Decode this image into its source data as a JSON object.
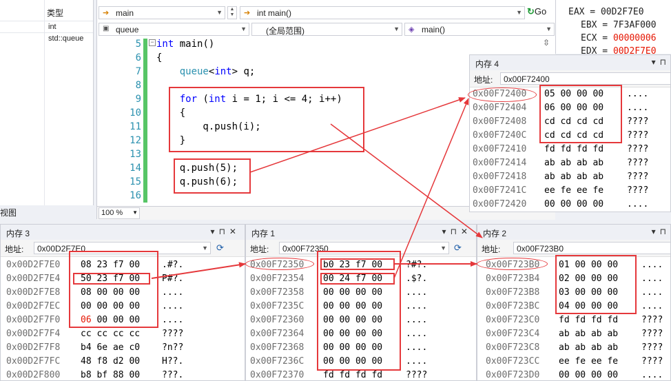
{
  "locals": {
    "header": "类型",
    "rows": [
      "int",
      "std::queue"
    ],
    "bottom_label": "视图"
  },
  "editor": {
    "nav_combo1": "main",
    "nav_combo2": "int main()",
    "go_label": "Go",
    "scope_combo1": "queue",
    "scope_combo2": "(全局范围)",
    "scope_combo3": "main()",
    "zoom": "100 %",
    "line_numbers": [
      "5",
      "6",
      "7",
      "8",
      "9",
      "10",
      "11",
      "12",
      "13",
      "14",
      "15",
      "16"
    ],
    "code_lines": [
      "int main()",
      "{",
      "    queue<int> q;",
      "",
      "    for (int i = 1; i <= 4; i++)",
      "    {",
      "        q.push(i);",
      "    }",
      "",
      "    q.push(5);",
      "    q.push(6);",
      ""
    ]
  },
  "registers": [
    {
      "name": "EAX",
      "value": "00D2F7E0",
      "changed": false
    },
    {
      "name": "EBX",
      "value": "7F3AF000",
      "changed": false
    },
    {
      "name": "ECX",
      "value": "00000006",
      "changed": true
    },
    {
      "name": "EDX",
      "value": "00D2F7E0",
      "changed": true
    }
  ],
  "mem4": {
    "title": "内存 4",
    "addr_label": "地址:",
    "address": "0x00F72400",
    "rows": [
      {
        "a": "0x00F72400",
        "h": "05 00 00 00",
        "c": "...."
      },
      {
        "a": "0x00F72404",
        "h": "06 00 00 00",
        "c": "...."
      },
      {
        "a": "0x00F72408",
        "h": "cd cd cd cd",
        "c": "????"
      },
      {
        "a": "0x00F7240C",
        "h": "cd cd cd cd",
        "c": "????"
      },
      {
        "a": "0x00F72410",
        "h": "fd fd fd fd",
        "c": "????"
      },
      {
        "a": "0x00F72414",
        "h": "ab ab ab ab",
        "c": "????"
      },
      {
        "a": "0x00F72418",
        "h": "ab ab ab ab",
        "c": "????"
      },
      {
        "a": "0x00F7241C",
        "h": "ee fe ee fe",
        "c": "????"
      },
      {
        "a": "0x00F72420",
        "h": "00 00 00 00",
        "c": "...."
      }
    ]
  },
  "mem3": {
    "title": "内存 3",
    "addr_label": "地址:",
    "address": "0x00D2F7E0",
    "rows": [
      {
        "a": "0x00D2F7E0",
        "h": "08 23 f7 00",
        "c": ".#?."
      },
      {
        "a": "0x00D2F7E4",
        "h": "50 23 f7 00",
        "c": "P#?."
      },
      {
        "a": "0x00D2F7E8",
        "h": "08 00 00 00",
        "c": "...."
      },
      {
        "a": "0x00D2F7EC",
        "h": "00 00 00 00",
        "c": "...."
      },
      {
        "a": "0x00D2F7F0",
        "h": "06 00 00 00",
        "c": "...."
      },
      {
        "a": "0x00D2F7F4",
        "h": "cc cc cc cc",
        "c": "????"
      },
      {
        "a": "0x00D2F7F8",
        "h": "b4 6e ae c0",
        "c": "?n??"
      },
      {
        "a": "0x00D2F7FC",
        "h": "48 f8 d2 00",
        "c": "H??."
      },
      {
        "a": "0x00D2F800",
        "h": "b8 bf 88 00",
        "c": "???."
      }
    ]
  },
  "mem1": {
    "title": "内存 1",
    "addr_label": "地址:",
    "address": "0x00F72350",
    "rows": [
      {
        "a": "0x00F72350",
        "h": "b0 23 f7 00",
        "c": "?#?."
      },
      {
        "a": "0x00F72354",
        "h": "00 24 f7 00",
        "c": ".$?."
      },
      {
        "a": "0x00F72358",
        "h": "00 00 00 00",
        "c": "...."
      },
      {
        "a": "0x00F7235C",
        "h": "00 00 00 00",
        "c": "...."
      },
      {
        "a": "0x00F72360",
        "h": "00 00 00 00",
        "c": "...."
      },
      {
        "a": "0x00F72364",
        "h": "00 00 00 00",
        "c": "...."
      },
      {
        "a": "0x00F72368",
        "h": "00 00 00 00",
        "c": "...."
      },
      {
        "a": "0x00F7236C",
        "h": "00 00 00 00",
        "c": "...."
      },
      {
        "a": "0x00F72370",
        "h": "fd fd fd fd",
        "c": "????"
      }
    ]
  },
  "mem2": {
    "title": "内存 2",
    "addr_label": "地址:",
    "address": "0x00F723B0",
    "rows": [
      {
        "a": "0x00F723B0",
        "h": "01 00 00 00",
        "c": "...."
      },
      {
        "a": "0x00F723B4",
        "h": "02 00 00 00",
        "c": "...."
      },
      {
        "a": "0x00F723B8",
        "h": "03 00 00 00",
        "c": "...."
      },
      {
        "a": "0x00F723BC",
        "h": "04 00 00 00",
        "c": "...."
      },
      {
        "a": "0x00F723C0",
        "h": "fd fd fd fd",
        "c": "????"
      },
      {
        "a": "0x00F723C4",
        "h": "ab ab ab ab",
        "c": "????"
      },
      {
        "a": "0x00F723C8",
        "h": "ab ab ab ab",
        "c": "????"
      },
      {
        "a": "0x00F723CC",
        "h": "ee fe ee fe",
        "c": "????"
      },
      {
        "a": "0x00F723D0",
        "h": "00 00 00 00",
        "c": "...."
      }
    ]
  },
  "colors": {
    "annotation": "#e5383b",
    "line_number": "#2b91af",
    "keyword": "#0000ff",
    "changed_register": "#e51400"
  }
}
